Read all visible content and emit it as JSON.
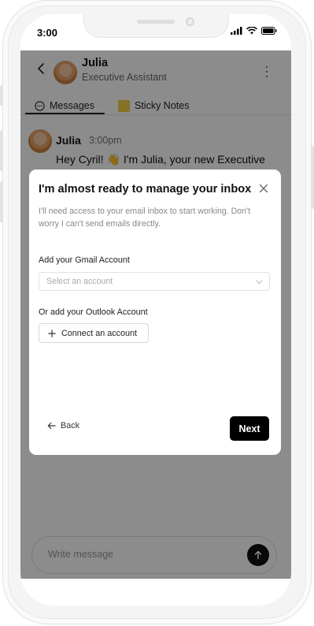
{
  "status_bar": {
    "time": "3:00"
  },
  "header": {
    "name": "Julia",
    "role": "Executive Assistant"
  },
  "tabs": [
    {
      "label": "Messages",
      "icon": "chat-bubble-icon",
      "active": true
    },
    {
      "label": "Sticky Notes",
      "icon": "sticky-note-icon",
      "active": false
    }
  ],
  "message": {
    "sender": "Julia",
    "time": "3:00pm",
    "text": "Hey Cyril! 👋 I'm Julia, your new Executive"
  },
  "composer": {
    "placeholder": "Write message"
  },
  "modal": {
    "title": "I'm almost ready to manage your inbox",
    "description": "I'll need access to your email inbox to start working. Don't worry I can't send emails directly.",
    "gmail_label": "Add your Gmail Account",
    "select_placeholder": "Select an account",
    "outlook_label": "Or add your Outlook Account",
    "connect_label": "Connect an account",
    "back_label": "Back",
    "next_label": "Next"
  },
  "colors": {
    "primary": "#000000",
    "overlay": "rgba(0,0,0,0.45)",
    "sticky": "#f2cf46"
  }
}
